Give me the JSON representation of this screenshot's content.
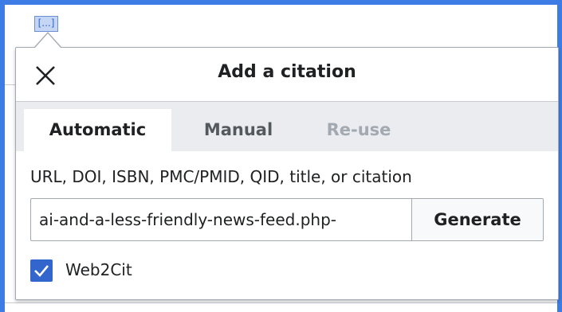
{
  "reference_marker": "[...]",
  "dialog": {
    "title": "Add a citation",
    "close_icon": "close-icon",
    "tabs": [
      {
        "label": "Automatic",
        "state": "active"
      },
      {
        "label": "Manual",
        "state": "normal"
      },
      {
        "label": "Re-use",
        "state": "disabled"
      }
    ],
    "automatic": {
      "field_label": "URL, DOI, ISBN, PMC/PMID, QID, title, or citation",
      "input_value": "-ai-and-a-less-friendly-news-feed.php",
      "generate_label": "Generate",
      "checkbox": {
        "label": "Web2Cit",
        "checked": true,
        "icon": "check-icon"
      }
    }
  },
  "colors": {
    "accent": "#3366cc",
    "frame": "#3d7ce4",
    "tabbar": "#eaecf0",
    "disabled_text": "#a2a9b1"
  }
}
